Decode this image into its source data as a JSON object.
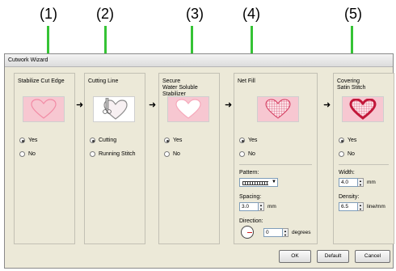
{
  "callouts": [
    "(1)",
    "(2)",
    "(3)",
    "(4)",
    "(5)"
  ],
  "window": {
    "title": "Cutwork Wizard"
  },
  "steps": [
    {
      "title": "Stabilize Cut Edge",
      "options": [
        {
          "label": "Yes",
          "selected": true
        },
        {
          "label": "No",
          "selected": false
        }
      ]
    },
    {
      "title": "Cutting Line",
      "options": [
        {
          "label": "Cutting",
          "selected": true
        },
        {
          "label": "Running Stitch",
          "selected": false
        }
      ]
    },
    {
      "title": "Secure\nWater Soluble Stabilizer",
      "options": [
        {
          "label": "Yes",
          "selected": true
        },
        {
          "label": "No",
          "selected": false
        }
      ]
    },
    {
      "title": "Net Fill",
      "options": [
        {
          "label": "Yes",
          "selected": true
        },
        {
          "label": "No",
          "selected": false
        }
      ],
      "pattern_label": "Pattern:",
      "spacing_label": "Spacing:",
      "spacing_value": "3.0",
      "spacing_unit": "mm",
      "direction_label": "Direction:",
      "direction_value": "0",
      "direction_unit": "degrees"
    },
    {
      "title": "Covering\nSatin Stitch",
      "options": [
        {
          "label": "Yes",
          "selected": true
        },
        {
          "label": "No",
          "selected": false
        }
      ],
      "width_label": "Width:",
      "width_value": "4.0",
      "width_unit": "mm",
      "density_label": "Density:",
      "density_value": "6.5",
      "density_unit": "line/mm"
    }
  ],
  "arrow": "➜",
  "buttons": {
    "ok": "OK",
    "default": "Default",
    "cancel": "Cancel"
  },
  "colors": {
    "callout_line": "#35c335",
    "thumb_bg": "#f7c7d1",
    "heart_fill": "#f4a6b8",
    "heart_outline": "#c2183a"
  }
}
